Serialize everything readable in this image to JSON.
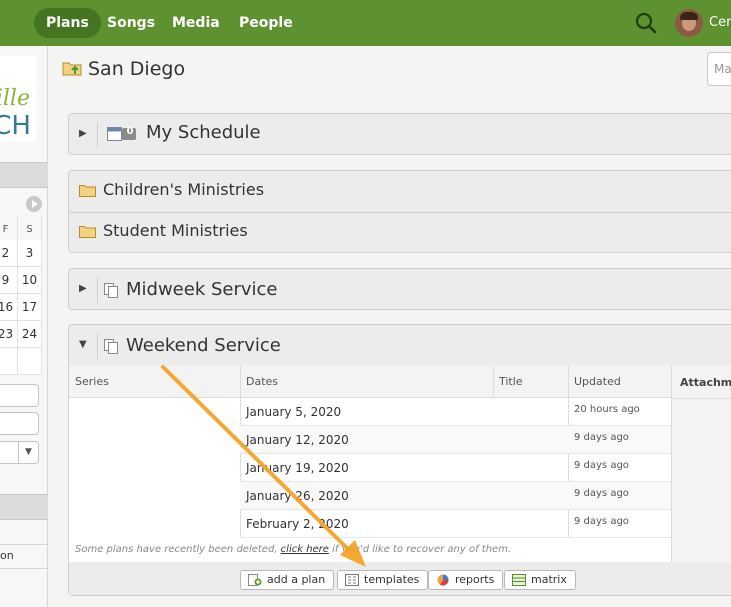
{
  "nav": {
    "tabs": [
      {
        "label": "Plans",
        "active": true
      },
      {
        "label": "Songs"
      },
      {
        "label": "Media"
      },
      {
        "label": "People"
      }
    ],
    "user_name": "Cen"
  },
  "left": {
    "logo_top": "ille",
    "logo_bottom": "CH",
    "calendar": {
      "day_headers": [
        "F",
        "S"
      ],
      "rows": [
        [
          "2",
          "3"
        ],
        [
          "9",
          "10"
        ],
        [
          "16",
          "17"
        ],
        [
          "23",
          "24"
        ]
      ]
    },
    "partial_text": "on"
  },
  "header": {
    "title": "San Diego",
    "input_partial": "Ma"
  },
  "panels": {
    "my_schedule": {
      "title": "My Schedule",
      "badge": "0"
    },
    "childrens": {
      "title": "Children's Ministries"
    },
    "student": {
      "title": "Student Ministries"
    },
    "midweek": {
      "title": "Midweek Service"
    },
    "weekend": {
      "title": "Weekend Service"
    }
  },
  "table": {
    "headers": {
      "series": "Series",
      "dates": "Dates",
      "title": "Title",
      "updated": "Updated",
      "attachments": "Attachme"
    },
    "rows": [
      {
        "date": "January 5, 2020",
        "updated": "20 hours ago"
      },
      {
        "date": "January 12, 2020",
        "updated": "9 days ago"
      },
      {
        "date": "January 19, 2020",
        "updated": "9 days ago"
      },
      {
        "date": "January 26, 2020",
        "updated": "9 days ago"
      },
      {
        "date": "February 2, 2020",
        "updated": "9 days ago"
      }
    ],
    "notice_pre": "Some plans have recently been deleted,",
    "notice_link": "click here",
    "notice_post": "if you'd like to recover any of them."
  },
  "actions": {
    "add_plan": "add a plan",
    "templates": "templates",
    "reports": "reports",
    "matrix": "matrix"
  },
  "colors": {
    "nav_green": "#5e9130",
    "annotation_arrow": "#f5a32a"
  }
}
